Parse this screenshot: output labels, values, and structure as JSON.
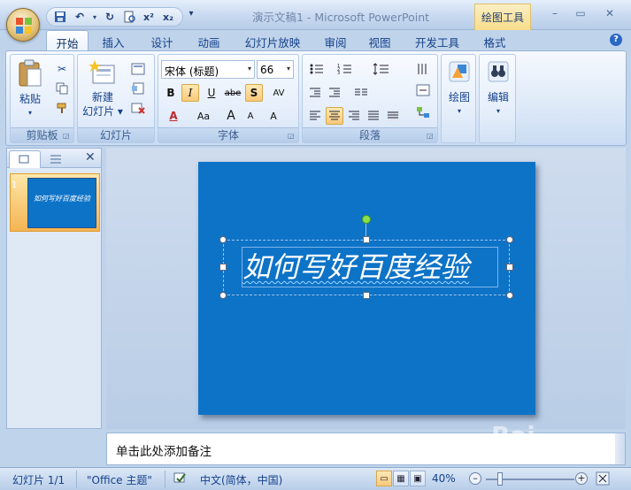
{
  "window": {
    "title": "演示文稿1 - Microsoft PowerPoint",
    "context_tab_group": "绘图工具",
    "minimize": "–",
    "maximize": "▭",
    "close": "✕"
  },
  "quick_access": {
    "more": "▾"
  },
  "tabs": [
    {
      "label": "开始",
      "active": true
    },
    {
      "label": "插入"
    },
    {
      "label": "设计"
    },
    {
      "label": "动画"
    },
    {
      "label": "幻灯片放映"
    },
    {
      "label": "审阅"
    },
    {
      "label": "视图"
    },
    {
      "label": "开发工具"
    },
    {
      "label": "格式"
    }
  ],
  "ribbon": {
    "clipboard": {
      "label": "剪贴板",
      "paste": "粘贴"
    },
    "slides": {
      "label": "幻灯片",
      "new_slide_line1": "新建",
      "new_slide_line2": "幻灯片 ▾"
    },
    "font": {
      "label": "字体",
      "font_name": "宋体 (标题)",
      "font_size": "66",
      "bold": "B",
      "italic": "I",
      "underline": "U",
      "strike": "abe",
      "shadow": "S",
      "spacing": "AV",
      "color": "A",
      "case": "Aa",
      "grow": "A",
      "shrink": "A",
      "clear": "A"
    },
    "paragraph": {
      "label": "段落"
    },
    "drawing": {
      "label": "绘图"
    },
    "editing": {
      "label": "编辑"
    }
  },
  "slide": {
    "title": "如何写好百度经验",
    "thumb_number": "1",
    "thumb_text": "如何写好百度经验"
  },
  "notes": {
    "placeholder": "单击此处添加备注"
  },
  "statusbar": {
    "slide_info": "幻灯片 1/1",
    "theme": "\"Office 主题\"",
    "language": "中文(简体，中国)",
    "zoom": "40%"
  },
  "watermark": "Bai"
}
